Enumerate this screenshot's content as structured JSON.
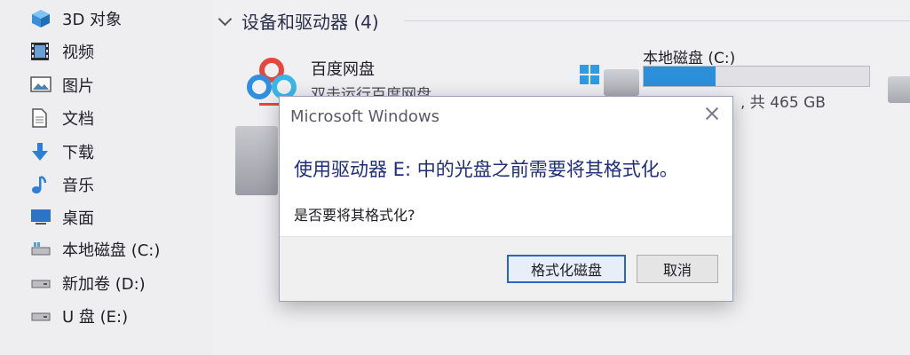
{
  "sidebar": {
    "items": [
      {
        "label": "3D 对象",
        "icon": "3d-object-icon"
      },
      {
        "label": "视频",
        "icon": "video-icon"
      },
      {
        "label": "图片",
        "icon": "picture-icon"
      },
      {
        "label": "文档",
        "icon": "document-icon"
      },
      {
        "label": "下载",
        "icon": "download-icon"
      },
      {
        "label": "音乐",
        "icon": "music-icon"
      },
      {
        "label": "桌面",
        "icon": "desktop-icon"
      },
      {
        "label": "本地磁盘 (C:)",
        "icon": "drive-icon"
      },
      {
        "label": "新加卷 (D:)",
        "icon": "drive-icon"
      },
      {
        "label": "U 盘 (E:)",
        "icon": "usb-drive-icon"
      }
    ]
  },
  "main": {
    "group_title": "设备和驱动器 (4)",
    "baidu": {
      "name": "百度网盘",
      "subtitle": "双击运行百度网盘"
    },
    "disk_c": {
      "name": "本地磁盘 (C:)",
      "free_text": ", 共 465 GB",
      "used_fraction": 0.32
    },
    "colors": {
      "accent": "#2b8fd9",
      "dialog_text": "#1f2d7a"
    }
  },
  "dialog": {
    "title": "Microsoft Windows",
    "message": "使用驱动器 E: 中的光盘之前需要将其格式化。",
    "question": "是否要将其格式化?",
    "format_button": "格式化磁盘",
    "cancel_button": "取消"
  }
}
